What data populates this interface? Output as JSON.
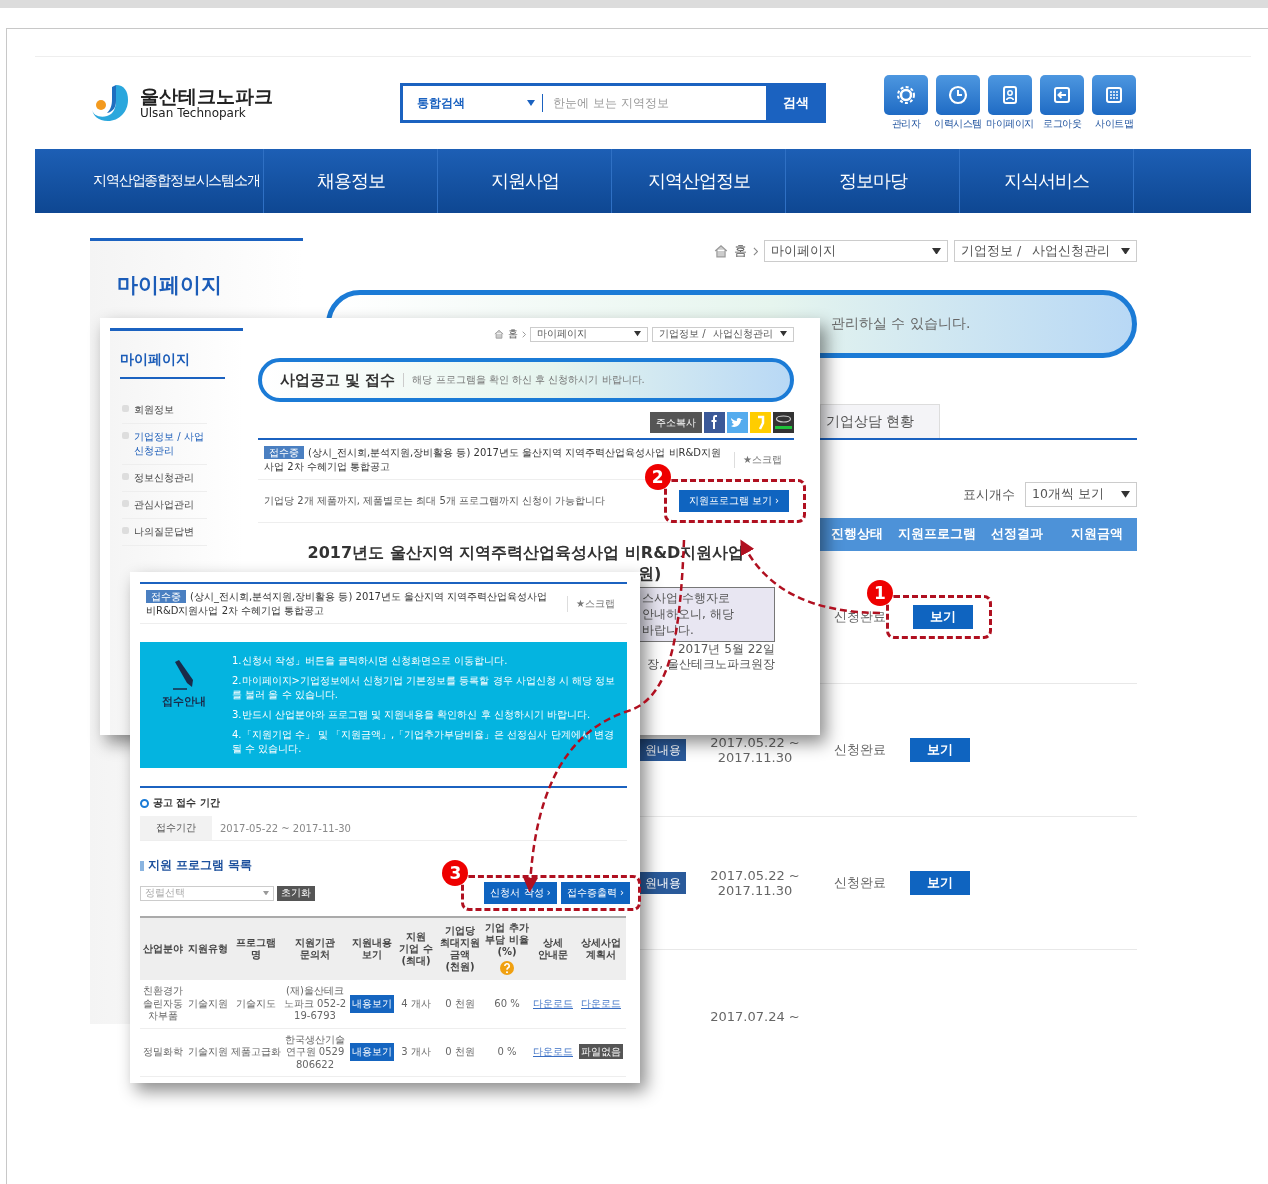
{
  "header": {
    "logo_title": "울산테크노파크",
    "logo_subtitle": "Ulsan Technopark",
    "search": {
      "scope": "통합검색",
      "placeholder": "한눈에 보는 지역정보",
      "button": "검색"
    },
    "utility_links": [
      {
        "label": "관리자",
        "kind": "gear"
      },
      {
        "label": "이력시스템",
        "kind": "clock"
      },
      {
        "label": "마이페이지",
        "kind": "card"
      },
      {
        "label": "로그아웃",
        "kind": "logout"
      },
      {
        "label": "사이트맵",
        "kind": "grid"
      }
    ]
  },
  "nav": [
    "지역산업종합정보시스템소개",
    "채용정보",
    "지원사업",
    "지역산업정보",
    "정보마당",
    "지식서비스"
  ],
  "sidebar": {
    "title": "마이페이지"
  },
  "breadcrumb": {
    "home": "홈",
    "menu": "마이페이지",
    "submenu_1": "기업정보 /",
    "submenu_2": "사업신청관리"
  },
  "banner": {
    "subtitle": "관리하실 수 있습니다."
  },
  "tabs": [
    {
      "label": "기업상담 현황",
      "selected": false
    }
  ],
  "page_size": {
    "label": "표시개수",
    "value": "10개씩 보기"
  },
  "table": {
    "columns": [
      "진행상태",
      "지원프로그램",
      "선정결과",
      "지원금액"
    ],
    "rows": [
      {
        "status": "신청완료",
        "action": "보기"
      },
      {
        "detail": "원내용",
        "period": "2017.05.22 ~ 2017.11.30",
        "status": "신청완료",
        "action": "보기"
      },
      {
        "detail": "원내용",
        "period": "2017.05.22 ~ 2017.11.30",
        "status": "신청완료",
        "action": "보기"
      },
      {
        "period": "2017.07.24 ~"
      }
    ]
  },
  "announcement_screen": {
    "sidebar": {
      "title": "마이페이지",
      "items": [
        {
          "label": "회원정보",
          "selected": false
        },
        {
          "label": "기업정보 / 사업신청관리",
          "selected": true
        },
        {
          "label": "정보신청관리",
          "selected": false
        },
        {
          "label": "관심사업관리",
          "selected": false
        },
        {
          "label": "나의질문답변",
          "selected": false
        }
      ]
    },
    "breadcrumb": {
      "home": "홈",
      "menu": "마이페이지",
      "submenu_1": "기업정보 /",
      "submenu_2": "사업신청관리"
    },
    "banner": {
      "title": "사업공고 및 접수",
      "subtitle": "해당 프로그램을 확인 하신 후 신청하시기 바랍니다."
    },
    "share": {
      "copy": "주소복사"
    },
    "notice": {
      "badge": "접수중",
      "title": "(상시_전시회,분석지원,장비활용 등) 2017년도 울산지역 지역주력산업육성사업 비R&D지원사업 2차 수혜기업 통합공고",
      "scrap": "★스크랩"
    },
    "limit_text": "기업당 2개 제품까지, 제품별로는 최대 5개 프로그램까지 신청이 가능합니다",
    "program_button": "지원프로그램 보기 ›",
    "heading": "2017년도 울산지역 지역주력산업육성사업 비R&D지원사업",
    "heading_tail": "원)",
    "body_lines": [
      "스사업 수행자로",
      "안내하오니, 해당",
      "바랍니다."
    ],
    "date": "2017년 5월 22일",
    "signature": "장, 울산테크노파크원장"
  },
  "application_screen": {
    "notice": {
      "badge": "접수중",
      "title": "(상시_전시회,분석지원,장비활용 등) 2017년도 울산지역 지역주력산업육성사업 비R&D지원사업 2차 수혜기업 통합공고",
      "scrap": "★스크랩"
    },
    "guide": {
      "title": "접수안내",
      "lines": [
        "1.신청서 작성」버튼을 클릭하시면 신청화면으로 이동합니다.",
        "2.마이페이지>기업정보에서 신청기업 기본정보를 등록할 경우 사업신청 시 해당 정보를 불러 올 수 있습니다.",
        "3.반드시 산업분야와 프로그램 및 지원내용을 확인하신 후 신청하시기 바랍니다.",
        "4.「지원기업 수」 및 「지원금액」,「기업추가부담비율」은 선정심사 단계에서 변경될 수 있습니다."
      ]
    },
    "period": {
      "title": "공고 접수 기간",
      "label": "접수기간",
      "value": "2017-05-22 ~ 2017-11-30"
    },
    "programs": {
      "title": "지원 프로그램 목록",
      "sort_placeholder": "정렬선택",
      "reset": "초기화",
      "apply": "신청서 작성 ›",
      "receipt": "접수증출력 ›",
      "columns": [
        "산업분야",
        "지원유형",
        "프로그램 명",
        "지원기관 문의처",
        "지원내용 보기",
        "지원 기업 수 (최대)",
        "기업당 최대지원 금액 (천원)",
        "기업 추가 부담 비율 (%)",
        "상세 안내문",
        "상세사업 계획서"
      ],
      "rows": [
        {
          "field": "친환경가솔린자동차부품",
          "type": "기술지원",
          "program": "기술지도",
          "agency": "(재)울산테크노파크",
          "phone": "052-219-6793",
          "view": "내용보기",
          "companies": "4 개사",
          "amount": "0 천원",
          "ratio": "60 %",
          "guide": {
            "kind": "link",
            "text": "다운로드"
          },
          "plan": {
            "kind": "link",
            "text": "다운로드"
          }
        },
        {
          "field": "정밀화학",
          "type": "기술지원",
          "program": "제품고급화",
          "agency": "한국생산기술연구원",
          "phone": "0529806622",
          "view": "내용보기",
          "companies": "3 개사",
          "amount": "0 천원",
          "ratio": "0 %",
          "guide": {
            "kind": "link",
            "text": "다운로드"
          },
          "plan": {
            "kind": "none",
            "text": "파일없음"
          }
        }
      ]
    }
  },
  "callouts": [
    {
      "number": "1"
    },
    {
      "number": "2"
    },
    {
      "number": "3"
    }
  ]
}
